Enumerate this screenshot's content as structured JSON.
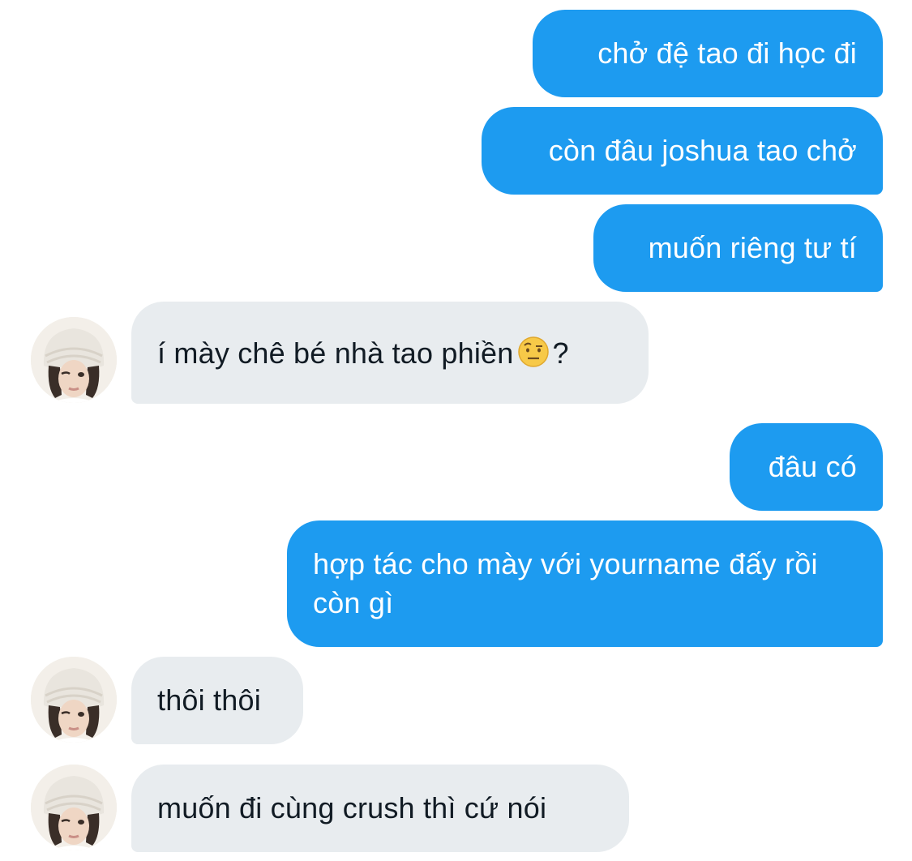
{
  "messages": [
    {
      "direction": "out",
      "text": "chở đệ tao đi học đi"
    },
    {
      "direction": "out",
      "text": "còn đâu joshua tao chở"
    },
    {
      "direction": "out",
      "text": "muốn riêng tư tí"
    },
    {
      "direction": "in",
      "text_before_emoji": "í mày chê bé nhà tao phiền",
      "emoji": "face-with-raised-eyebrow",
      "text_after_emoji": "?"
    },
    {
      "direction": "out",
      "text": "đâu có"
    },
    {
      "direction": "out",
      "text": "hợp tác cho mày với yourname đấy rồi còn gì"
    },
    {
      "direction": "in",
      "text": "thôi thôi"
    },
    {
      "direction": "in",
      "text": "muốn đi cùng crush thì cứ nói"
    }
  ],
  "colors": {
    "outgoing_bubble": "#1d9bf0",
    "incoming_bubble": "#e8ecef",
    "incoming_text": "#111b24",
    "outgoing_text": "#ffffff"
  },
  "avatar": {
    "icon": "user-avatar-photo"
  }
}
